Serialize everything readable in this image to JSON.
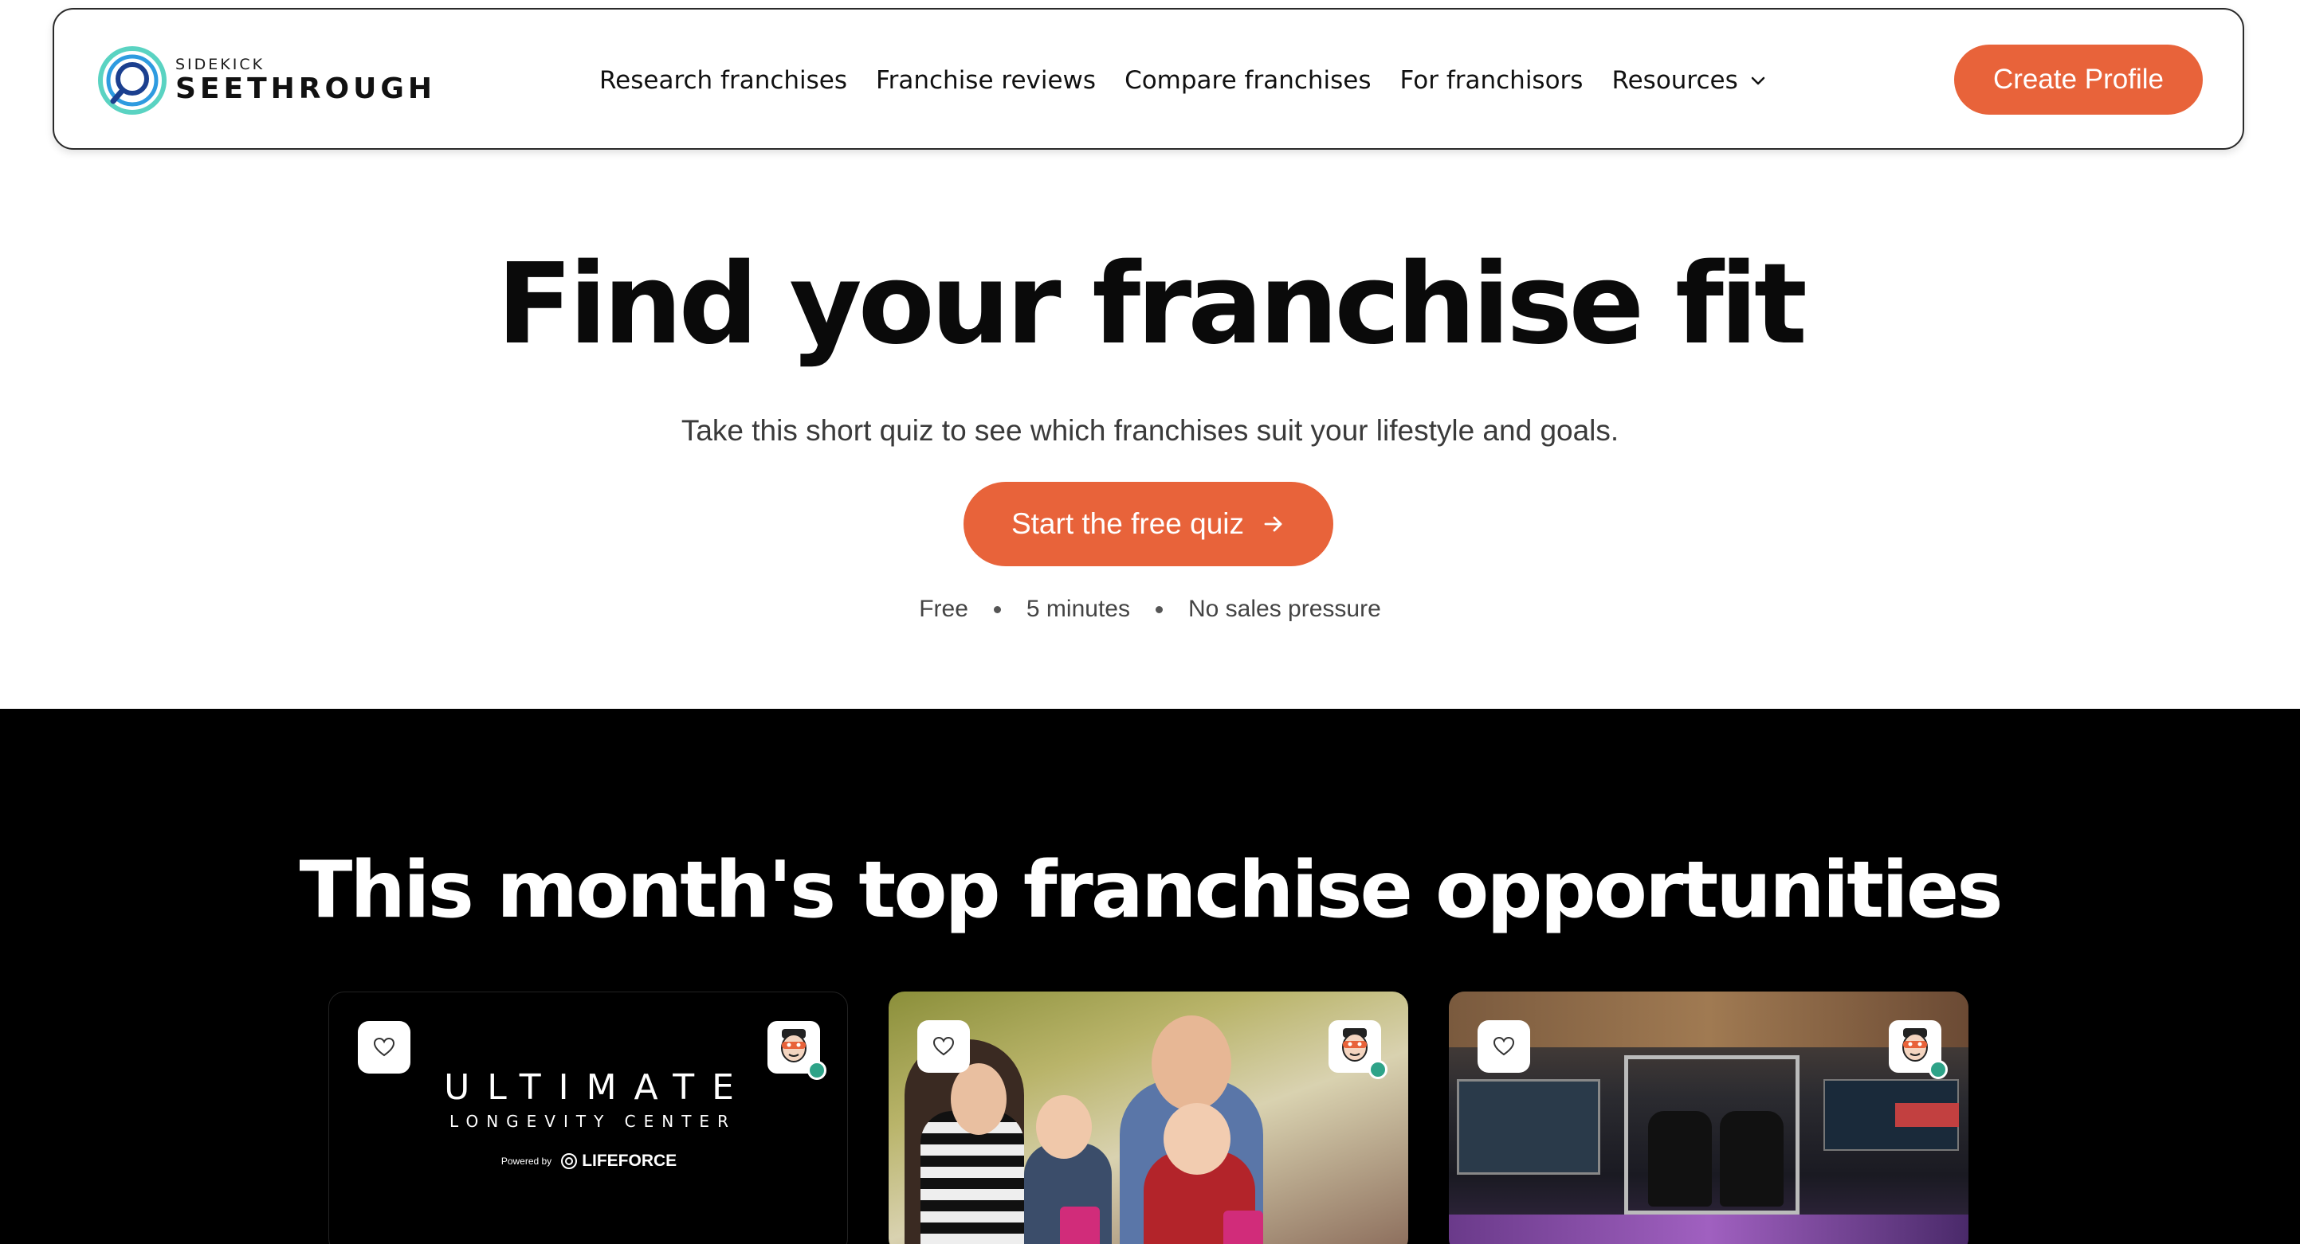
{
  "brand": {
    "top": "SIDEKICK",
    "name": "SEETHROUGH"
  },
  "nav": {
    "links": [
      "Research franchises",
      "Franchise reviews",
      "Compare franchises",
      "For franchisors",
      "Resources"
    ],
    "cta": "Create Profile"
  },
  "hero": {
    "title": "Find your franchise fit",
    "subtitle": "Take this short quiz to see which franchises suit your lifestyle and goals.",
    "button": "Start the free quiz",
    "meta": [
      "Free",
      "5 minutes",
      "No sales pressure"
    ]
  },
  "top": {
    "title": "This month's top franchise opportunities",
    "card1": {
      "line1": "ULTIMATE",
      "line2": "LONGEVITY CENTER",
      "powered": "Powered by",
      "brand": "LIFEFORCE"
    }
  },
  "colors": {
    "accent": "#e8633a",
    "dark": "#000000",
    "verified": "#2ea388"
  },
  "icons": {
    "logo": "magnifier-logo-icon",
    "heart": "heart-icon",
    "chevron": "chevron-down-icon",
    "arrow": "arrow-right-icon",
    "avatar": "sidekick-mascot-icon"
  }
}
